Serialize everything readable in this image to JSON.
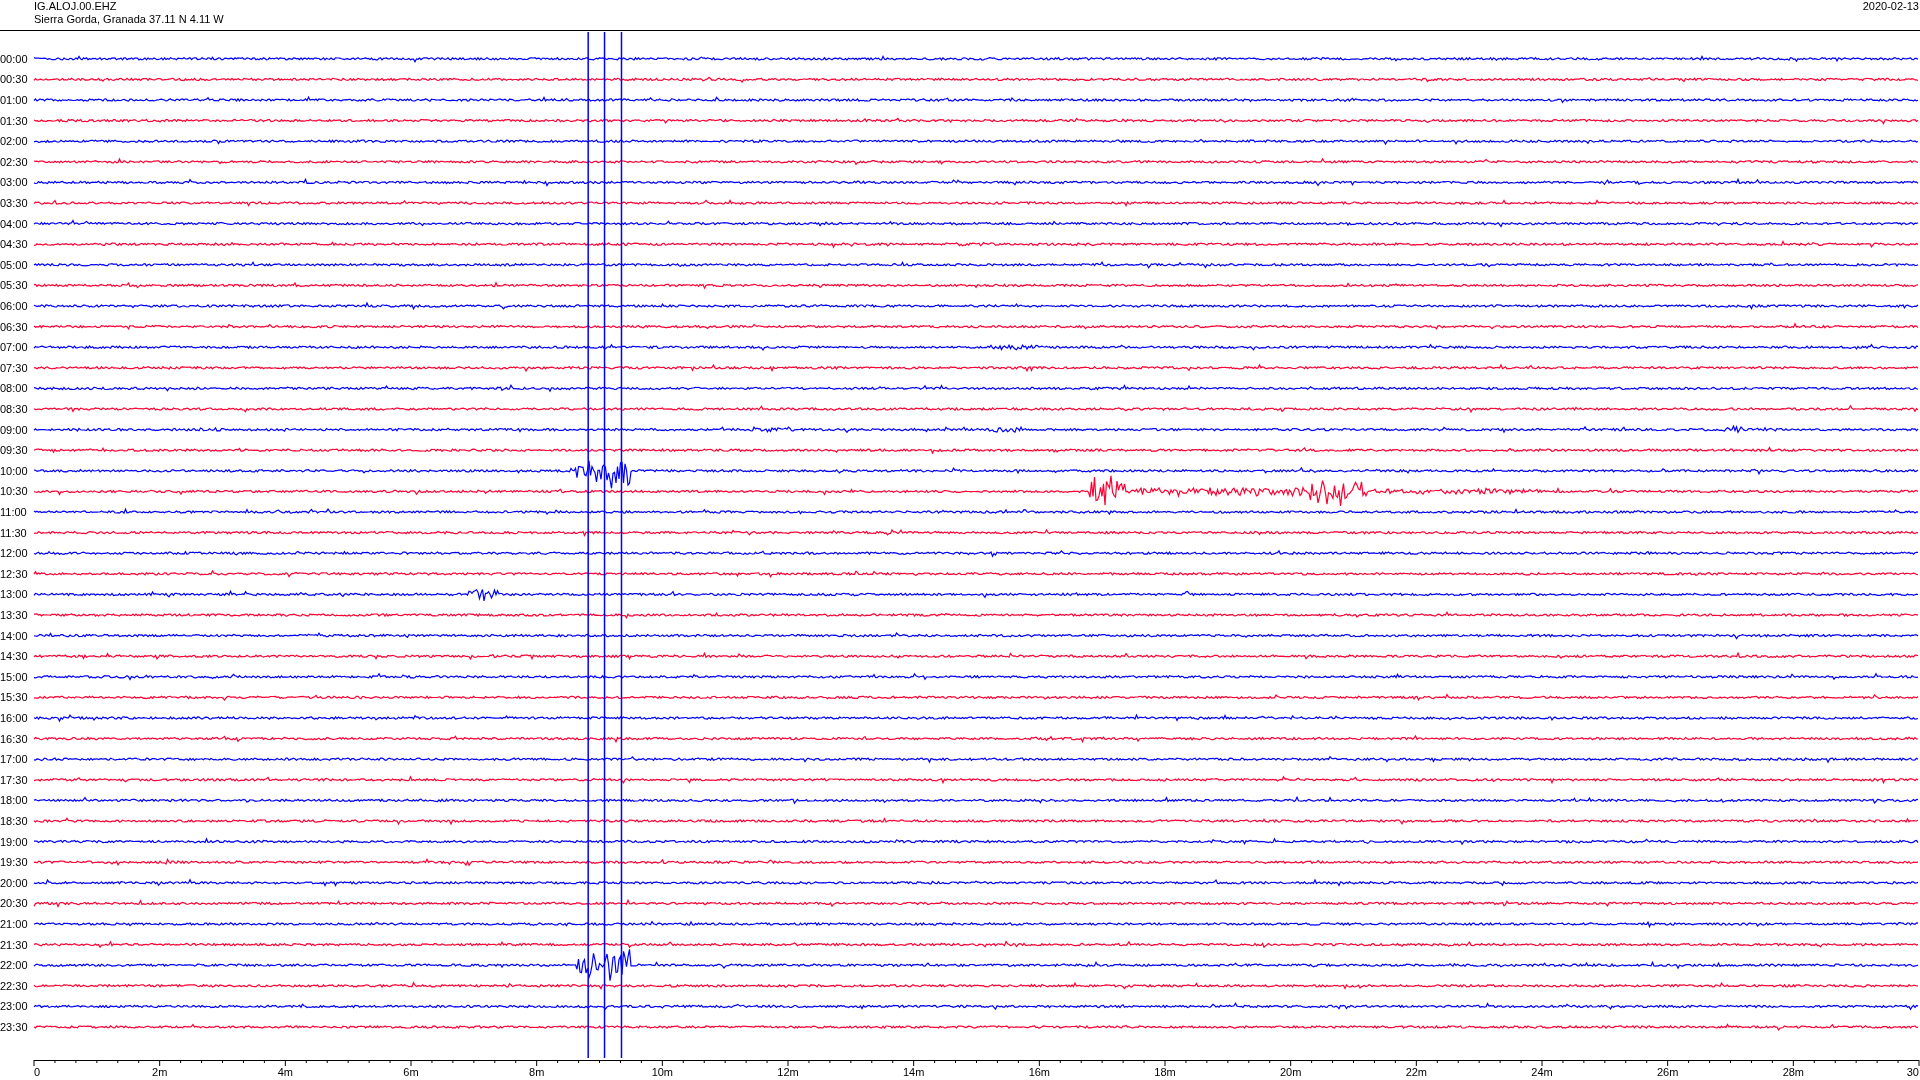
{
  "header": {
    "station": "IG.ALOJ.00.EHZ",
    "location": "Sierra Gorda, Granada  37.11 N 4.11 W",
    "date": "2020-02-13"
  },
  "rows": [
    {
      "label": "00:00",
      "color": "#0000ff"
    },
    {
      "label": "00:30",
      "color": "#ff0033"
    },
    {
      "label": "01:00",
      "color": "#0000ff"
    },
    {
      "label": "01:30",
      "color": "#ff0033"
    },
    {
      "label": "02:00",
      "color": "#0000ff"
    },
    {
      "label": "02:30",
      "color": "#ff0033"
    },
    {
      "label": "03:00",
      "color": "#0000ff"
    },
    {
      "label": "03:30",
      "color": "#ff0033"
    },
    {
      "label": "04:00",
      "color": "#0000ff"
    },
    {
      "label": "04:30",
      "color": "#ff0033"
    },
    {
      "label": "05:00",
      "color": "#0000ff"
    },
    {
      "label": "05:30",
      "color": "#ff0033"
    },
    {
      "label": "06:00",
      "color": "#0000ff"
    },
    {
      "label": "06:30",
      "color": "#ff0033"
    },
    {
      "label": "07:00",
      "color": "#0000ff"
    },
    {
      "label": "07:30",
      "color": "#ff0033"
    },
    {
      "label": "08:00",
      "color": "#0000ff"
    },
    {
      "label": "08:30",
      "color": "#ff0033"
    },
    {
      "label": "09:00",
      "color": "#0000ff"
    },
    {
      "label": "09:30",
      "color": "#ff0033"
    },
    {
      "label": "10:00",
      "color": "#0000ff"
    },
    {
      "label": "10:30",
      "color": "#ff0033"
    },
    {
      "label": "11:00",
      "color": "#0000ff"
    },
    {
      "label": "11:30",
      "color": "#ff0033"
    },
    {
      "label": "12:00",
      "color": "#0000ff"
    },
    {
      "label": "12:30",
      "color": "#ff0033"
    },
    {
      "label": "13:00",
      "color": "#0000ff"
    },
    {
      "label": "13:30",
      "color": "#ff0033"
    },
    {
      "label": "14:00",
      "color": "#0000ff"
    },
    {
      "label": "14:30",
      "color": "#ff0033"
    },
    {
      "label": "15:00",
      "color": "#0000ff"
    },
    {
      "label": "15:30",
      "color": "#ff0033"
    },
    {
      "label": "16:00",
      "color": "#0000ff"
    },
    {
      "label": "16:30",
      "color": "#ff0033"
    },
    {
      "label": "17:00",
      "color": "#0000ff"
    },
    {
      "label": "17:30",
      "color": "#ff0033"
    },
    {
      "label": "18:00",
      "color": "#0000ff"
    },
    {
      "label": "18:30",
      "color": "#ff0033"
    },
    {
      "label": "19:00",
      "color": "#0000ff"
    },
    {
      "label": "19:30",
      "color": "#ff0033"
    },
    {
      "label": "20:00",
      "color": "#0000ff"
    },
    {
      "label": "20:30",
      "color": "#ff0033"
    },
    {
      "label": "21:00",
      "color": "#0000ff"
    },
    {
      "label": "21:30",
      "color": "#ff0033"
    },
    {
      "label": "22:00",
      "color": "#0000ff"
    },
    {
      "label": "22:30",
      "color": "#ff0033"
    },
    {
      "label": "23:00",
      "color": "#0000ff"
    },
    {
      "label": "23:30",
      "color": "#ff0033"
    }
  ],
  "x_axis": {
    "ticks": [
      "0",
      "2m",
      "4m",
      "6m",
      "8m",
      "10m",
      "12m",
      "14m",
      "16m",
      "18m",
      "20m",
      "22m",
      "24m",
      "26m",
      "28m",
      "30"
    ]
  }
}
